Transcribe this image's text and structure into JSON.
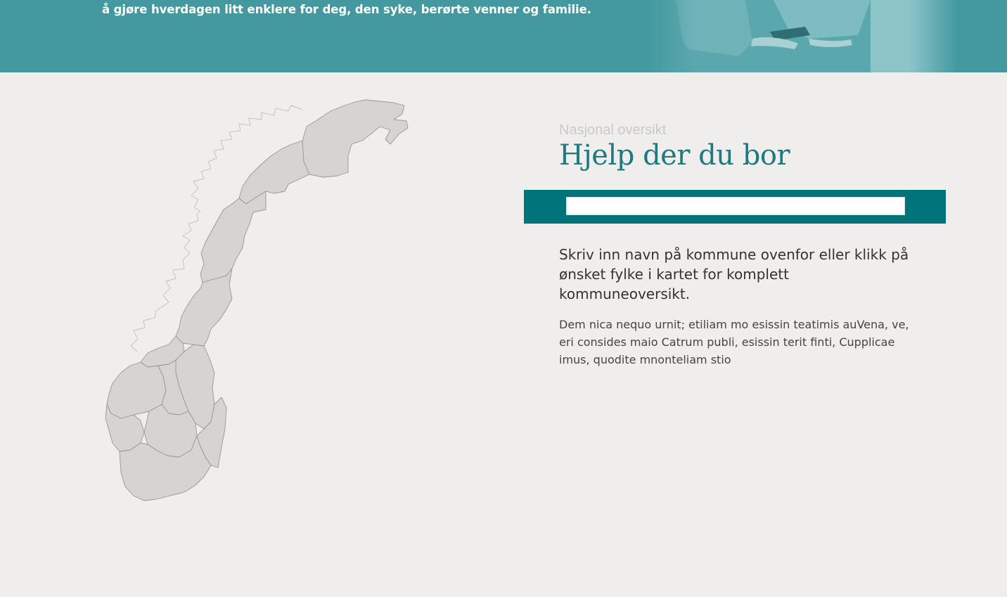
{
  "hero": {
    "tagline": "å gjøre hverdagen litt enklere for deg, den syke, berørte venner og familie."
  },
  "section": {
    "eyebrow": "Nasjonal oversikt",
    "title": "Hjelp der du bor",
    "search": {
      "placeholder": "",
      "value": ""
    },
    "lead": "Skriv inn navn på kommune ovenfor eller klikk på ønsket fylke i kartet for komplett kommuneoversikt.",
    "body": "Dem nica nequo urnit; etiliam mo esissin teatimis auVena, ve, eri consides maio Catrum publi, esissin terit finti, Cupplicae imus, quodite mnonteliam stio"
  },
  "colors": {
    "hero": "#4499a0",
    "accent": "#007479",
    "title": "#1f7a80",
    "page_bg": "#efeeec",
    "map_fill": "#d6d3d2",
    "map_stroke": "#9a9696"
  },
  "map": {
    "icon": "norway-county-map"
  }
}
